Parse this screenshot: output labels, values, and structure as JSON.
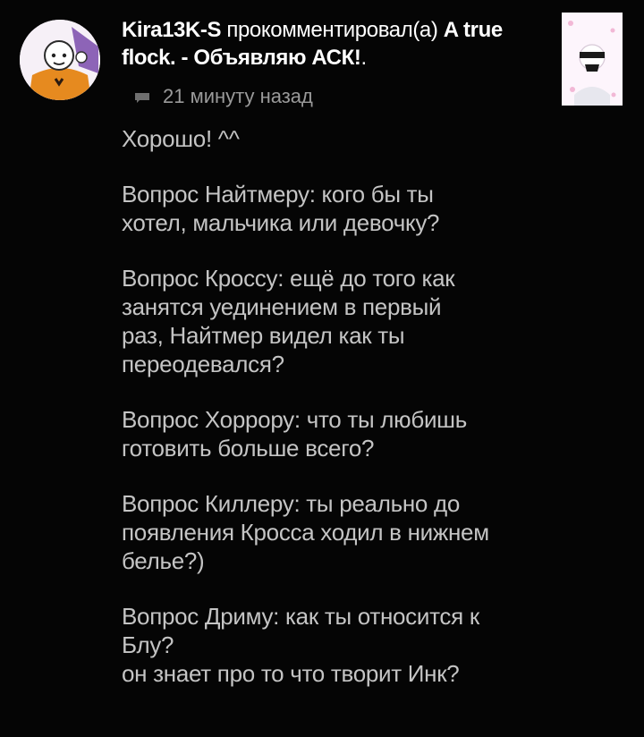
{
  "notification": {
    "username": "Kira13K-S",
    "action_text": " прокомментировал(а) ",
    "post_title": "A true flock. - Объявляю АСК!",
    "post_suffix": ".",
    "time": "21 минуту назад"
  },
  "icons": {
    "avatar": "user-avatar-illustration",
    "meta": "chat-bubble-icon",
    "thumbnail": "post-thumbnail-image"
  },
  "comment": {
    "lines": [
      [
        "Хорошо! ^^"
      ],
      [
        "Вопрос Найтмеру: кого бы ты",
        "хотел, мальчика или девочку?"
      ],
      [
        "Вопрос Кроссу: ещё до того как",
        "занятся уединением в первый",
        "раз, Найтмер видел как ты",
        "переодевался?"
      ],
      [
        "Вопрос Хоррору: что ты любишь",
        "готовить больше всего?"
      ],
      [
        "Вопрос Киллеру: ты реально до",
        "появления Кросса ходил в нижнем",
        "белье?)"
      ],
      [
        "Вопрос Дриму: как ты относится к",
        "Блу?",
        "он знает про то что творит Инк?"
      ]
    ]
  },
  "colors": {
    "background": "#050505",
    "header_text": "#ffffff",
    "meta_text": "#9a9a9a",
    "comment_text": "#c4c4c4"
  }
}
